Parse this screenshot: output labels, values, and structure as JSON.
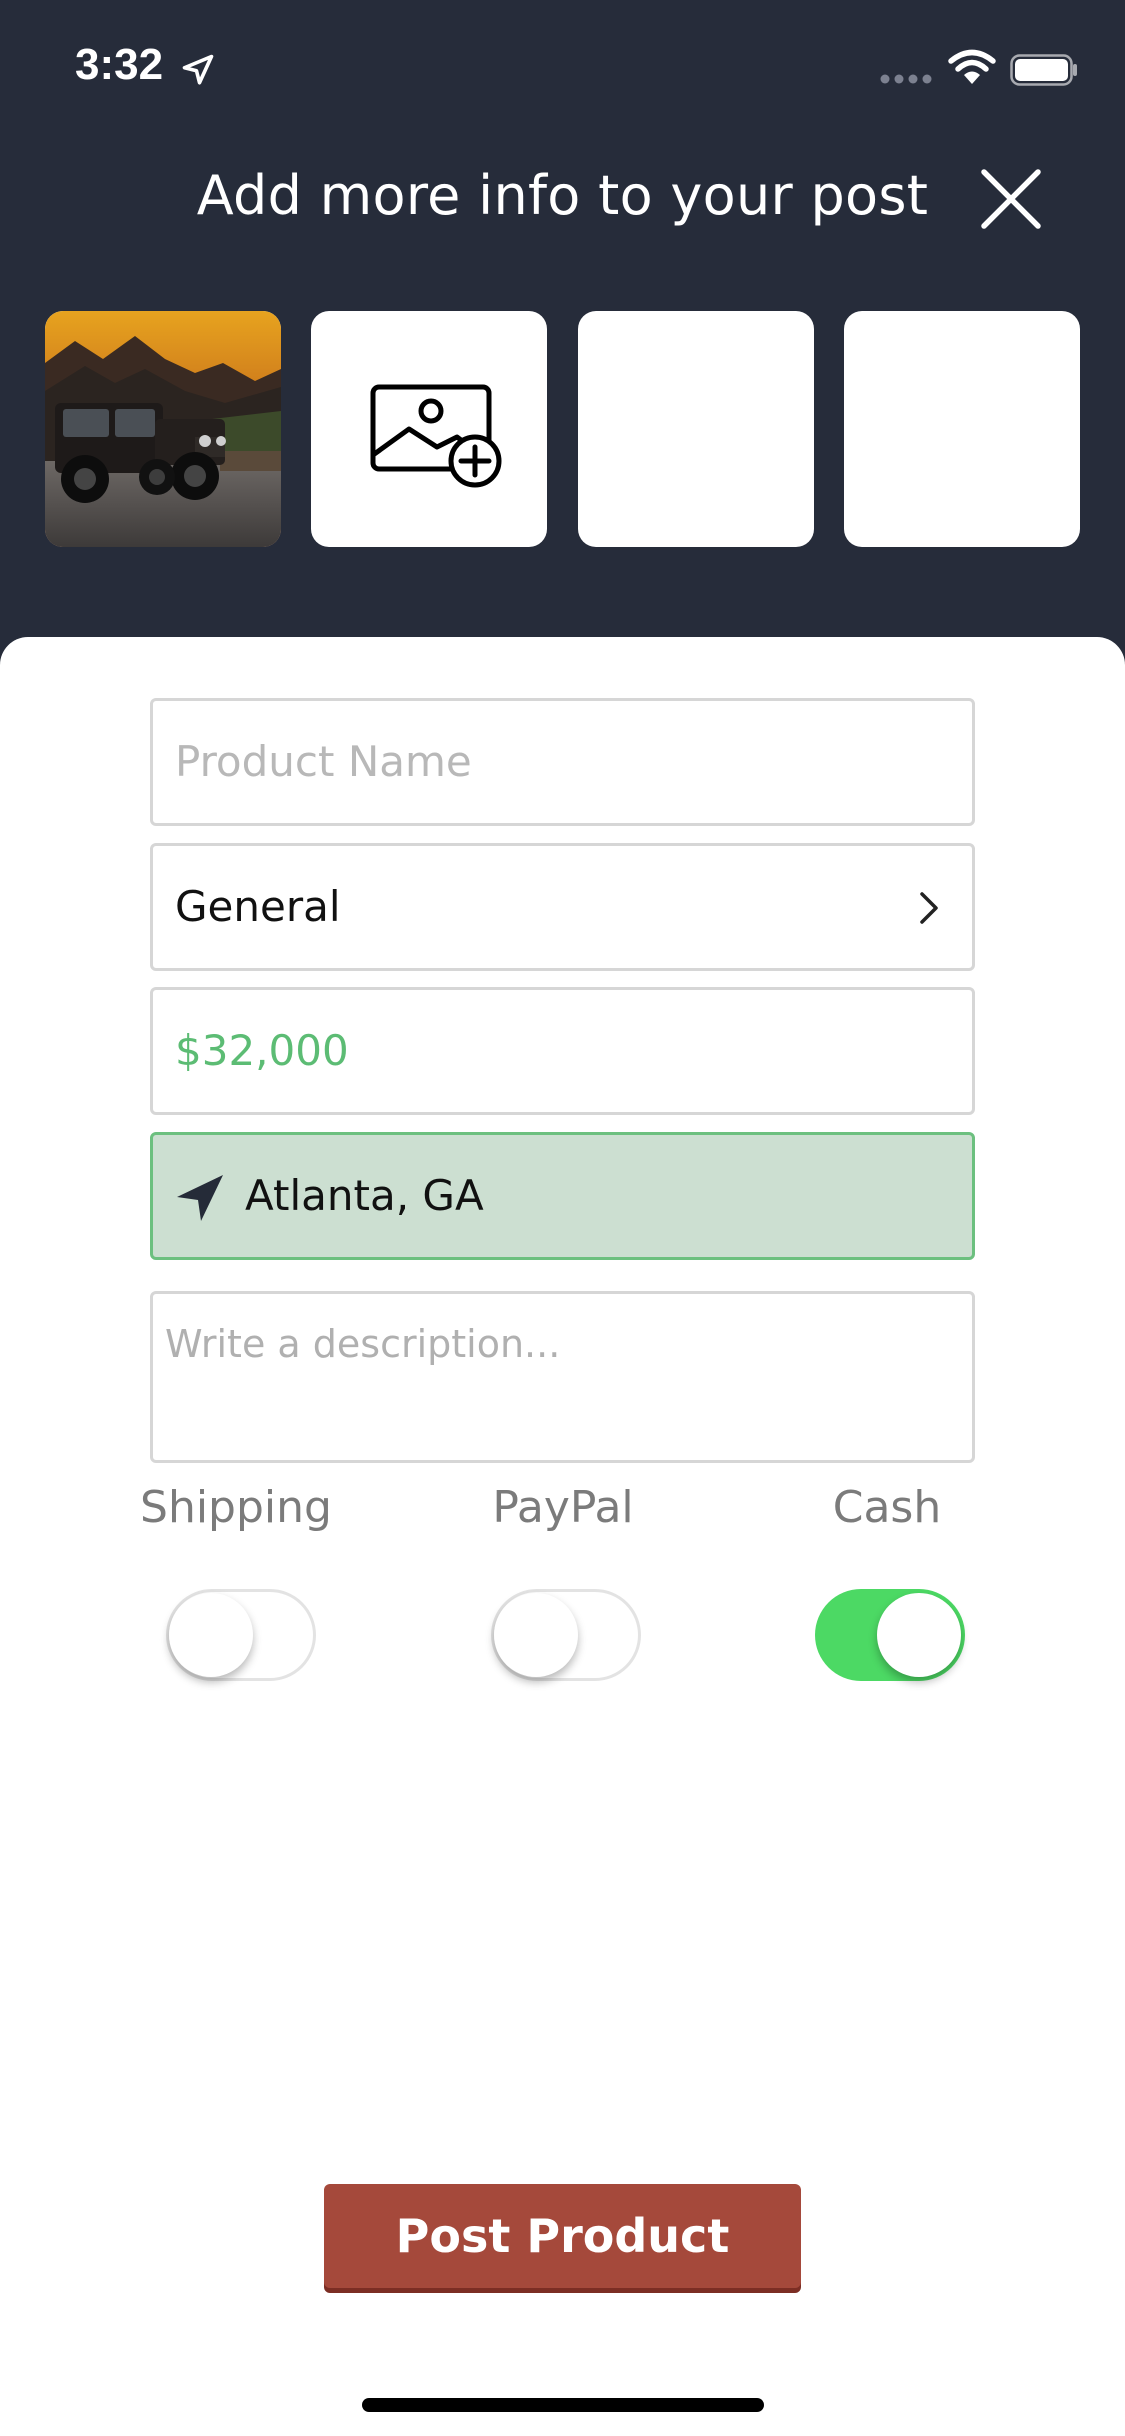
{
  "status_bar": {
    "time": "3:32"
  },
  "header": {
    "title": "Add more info to your post"
  },
  "photos": {
    "slot_1": "jeep-photo",
    "slot_2": "add-photo-icon",
    "slot_3": "empty",
    "slot_4": "empty"
  },
  "form": {
    "product_name_placeholder": "Product Name",
    "category_value": "General",
    "price_value": "$32,000",
    "location_value": "Atlanta, GA",
    "description_placeholder": "Write a description..."
  },
  "payment_options": [
    {
      "label": "Shipping",
      "enabled": false
    },
    {
      "label": "PayPal",
      "enabled": false
    },
    {
      "label": "Cash",
      "enabled": true
    }
  ],
  "actions": {
    "post_label": "Post Product"
  },
  "colors": {
    "header_bg": "#262c3a",
    "price_green": "#5cbc74",
    "location_bg": "#ccdfd1",
    "toggle_on": "#4cd964",
    "post_button": "#a5493b"
  }
}
